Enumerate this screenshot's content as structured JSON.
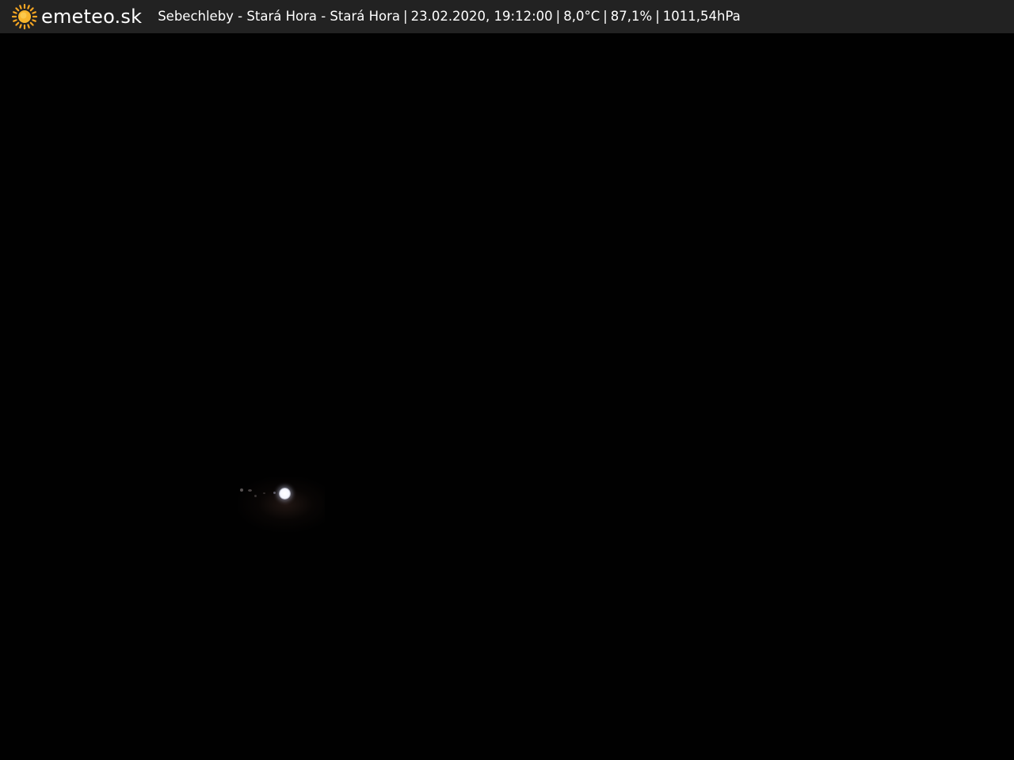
{
  "overlay": {
    "brand": "emeteo.sk",
    "location": "Sebechleby - Stará Hora - Stará Hora",
    "datetime": "23.02.2020, 19:12:00",
    "temperature": "8,0°C",
    "humidity": "87,1%",
    "pressure": "1011,54hPa",
    "separator": "|",
    "logo_icon": "sun-icon",
    "logo_color": "#f5a623",
    "bar_color": "#222222",
    "text_color": "#ffffff"
  },
  "scene": {
    "description_icon": "night-sky",
    "background_color": "#010101",
    "light_color": "#ffffff"
  }
}
